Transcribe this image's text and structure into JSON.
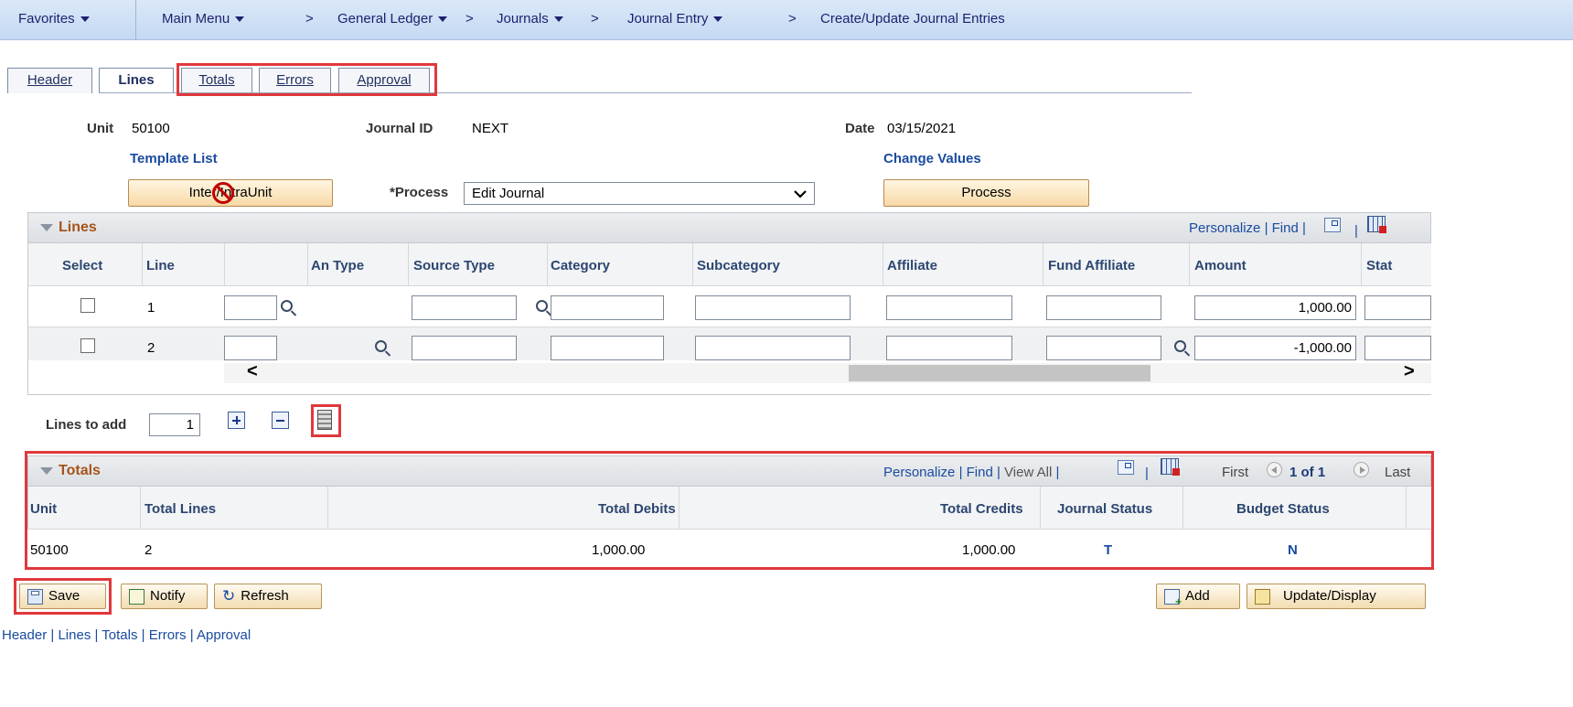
{
  "nav": {
    "favorites": "Favorites",
    "main_menu": "Main Menu",
    "sep": ">",
    "general_ledger": "General Ledger",
    "journals": "Journals",
    "journal_entry": "Journal Entry",
    "current": "Create/Update Journal Entries"
  },
  "tabs": {
    "header": "Header",
    "lines": "Lines",
    "totals": "Totals",
    "errors": "Errors",
    "approval": "Approval"
  },
  "form": {
    "unit_label": "Unit",
    "unit_value": "50100",
    "journal_id_label": "Journal ID",
    "journal_id_value": "NEXT",
    "date_label": "Date",
    "date_value": "03/15/2021",
    "template_list": "Template List",
    "change_values": "Change Values",
    "inter_unit_button": "Inter/IntraUnit",
    "process_label": "*Process",
    "process_value": "Edit Journal",
    "process_button": "Process"
  },
  "lines_grid": {
    "title": "Lines",
    "personalize": "Personalize",
    "find": "Find",
    "sep": "|",
    "columns": {
      "select": "Select",
      "line": "Line",
      "an_type": "An Type",
      "source_type": "Source Type",
      "category": "Category",
      "subcategory": "Subcategory",
      "affiliate": "Affiliate",
      "fund_affiliate": "Fund Affiliate",
      "amount": "Amount",
      "stat": "Stat"
    },
    "rows": [
      {
        "line": "1",
        "amount": "1,000.00"
      },
      {
        "line": "2",
        "amount": "-1,000.00"
      }
    ],
    "scroll_left": "<",
    "scroll_right": ">"
  },
  "lines_to_add": {
    "label": "Lines to add",
    "value": "1"
  },
  "totals_grid": {
    "title": "Totals",
    "personalize": "Personalize",
    "find": "Find",
    "view_all": "View All",
    "sep": "|",
    "first": "First",
    "page": "1 of 1",
    "last": "Last",
    "columns": {
      "unit": "Unit",
      "total_lines": "Total Lines",
      "total_debits": "Total Debits",
      "total_credits": "Total Credits",
      "journal_status": "Journal Status",
      "budget_status": "Budget Status"
    },
    "row": {
      "unit": "50100",
      "total_lines": "2",
      "total_debits": "1,000.00",
      "total_credits": "1,000.00",
      "journal_status": "T",
      "budget_status": "N"
    }
  },
  "toolbar": {
    "save": "Save",
    "notify": "Notify",
    "refresh": "Refresh",
    "add": "Add",
    "update_display": "Update/Display"
  },
  "footer_links": {
    "header": "Header",
    "lines": "Lines",
    "totals": "Totals",
    "errors": "Errors",
    "approval": "Approval",
    "sep": "|"
  }
}
